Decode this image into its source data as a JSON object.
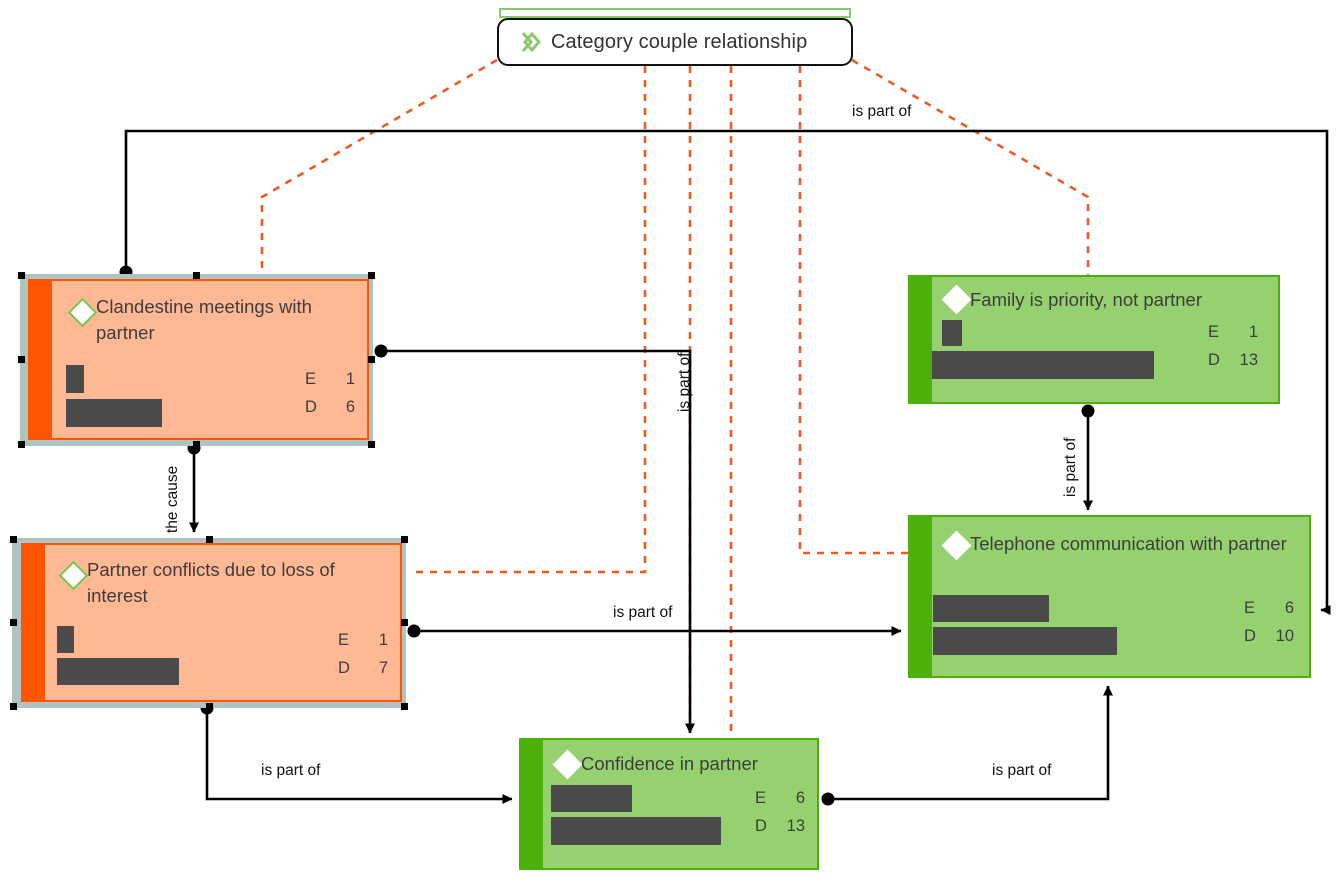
{
  "diagram": {
    "title_node": {
      "label": "Category couple relationship",
      "icon": "double-chevron-diamond-icon",
      "accent_color": "#8CC96B",
      "border_color": "#111111"
    },
    "metric_keys": {
      "e": "E",
      "d": "D"
    },
    "nodes": [
      {
        "id": "clandestine",
        "title": "Clandestine meetings with partner",
        "kind": "orange",
        "selected": true,
        "icon": "white-diamond-green-outline-icon",
        "accent_color": "#FF5500",
        "body_color": "#FFB894",
        "e_label": "E",
        "e_value": "1",
        "d_label": "D",
        "d_value": "6",
        "bar_small_w": 18,
        "bar_large_w": 96
      },
      {
        "id": "conflicts",
        "title": "Partner conflicts due to loss of interest",
        "kind": "orange",
        "selected": true,
        "icon": "white-diamond-green-outline-icon",
        "accent_color": "#FF5500",
        "body_color": "#FFB894",
        "e_label": "E",
        "e_value": "1",
        "d_label": "D",
        "d_value": "7",
        "bar_small_w": 17,
        "bar_large_w": 122
      },
      {
        "id": "family",
        "title": "Family is priority, not partner",
        "kind": "green",
        "selected": false,
        "icon": "white-diamond-icon",
        "accent_color": "#4CB00A",
        "body_color": "#96D170",
        "e_label": "E",
        "e_value": "1",
        "d_label": "D",
        "d_value": "13",
        "bar_small_w": 20,
        "bar_large_w": 222
      },
      {
        "id": "telephone",
        "title": "Telephone communication with partner",
        "kind": "green",
        "selected": false,
        "icon": "white-diamond-icon",
        "accent_color": "#4CB00A",
        "body_color": "#96D170",
        "e_label": "E",
        "e_value": "6",
        "d_label": "D",
        "d_value": "10",
        "bar_small_w": 116,
        "bar_large_w": 184
      },
      {
        "id": "confidence",
        "title": "Confidence in partner",
        "kind": "green",
        "selected": false,
        "icon": "white-diamond-icon",
        "accent_color": "#4CB00A",
        "body_color": "#96D170",
        "e_label": "E",
        "e_value": "6",
        "d_label": "D",
        "d_value": "13",
        "bar_small_w": 81,
        "bar_large_w": 170
      }
    ],
    "edges": [
      {
        "id": "e-clandestine-telephone",
        "label": "is part of",
        "style": "solid-black"
      },
      {
        "id": "e-clandestine-confidence",
        "label": "is part of",
        "style": "solid-black"
      },
      {
        "id": "e-clandestine-conflicts",
        "label": "the cause",
        "style": "solid-black"
      },
      {
        "id": "e-conflicts-telephone",
        "label": "is part of",
        "style": "solid-black"
      },
      {
        "id": "e-conflicts-confidence",
        "label": "is part of",
        "style": "solid-black"
      },
      {
        "id": "e-family-telephone",
        "label": "is part of",
        "style": "solid-black"
      },
      {
        "id": "e-telephone-confidence",
        "label": "is part of",
        "style": "solid-black"
      },
      {
        "id": "e-category-clandestine",
        "label": "",
        "style": "dashed-orange"
      },
      {
        "id": "e-category-conflicts",
        "label": "",
        "style": "dashed-orange"
      },
      {
        "id": "e-category-confidence",
        "label": "",
        "style": "dashed-orange"
      },
      {
        "id": "e-category-telephone",
        "label": "",
        "style": "dashed-orange"
      },
      {
        "id": "e-category-family",
        "label": "",
        "style": "dashed-orange"
      }
    ],
    "edge_labels": {
      "top_right": "is part of",
      "left_vertical": "the cause",
      "mid_vertical": "is part of",
      "mid_horizontal": "is part of",
      "right_vertical": "is part of",
      "bottom_left": "is part of",
      "bottom_right": "is part of"
    },
    "colors": {
      "orange_accent": "#FF5500",
      "orange_body": "#FFB894",
      "green_accent": "#4CB00A",
      "green_body": "#96D170",
      "dashed_edge": "#F05A22",
      "solid_edge": "#000000",
      "bar": "#4A4A4A",
      "selection_frame": "#AFC4C2"
    }
  }
}
